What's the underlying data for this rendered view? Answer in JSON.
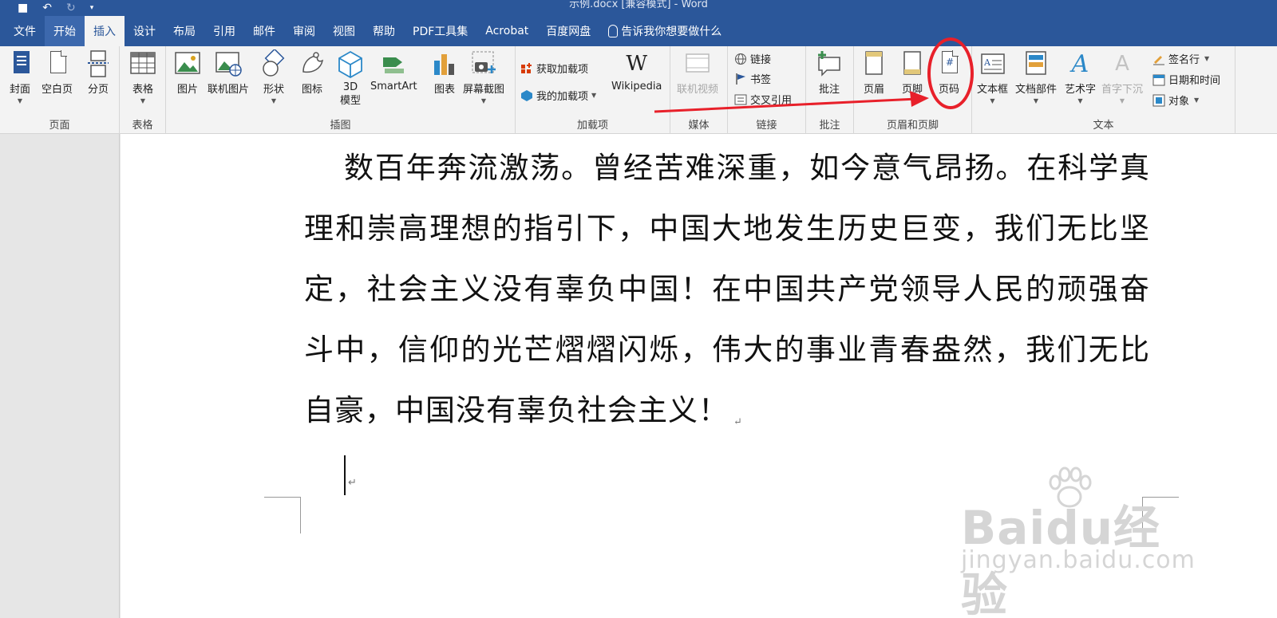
{
  "window": {
    "title": "示例.docx [兼容模式] - Word"
  },
  "tabs": [
    {
      "label": "文件"
    },
    {
      "label": "开始"
    },
    {
      "label": "插入"
    },
    {
      "label": "设计"
    },
    {
      "label": "布局"
    },
    {
      "label": "引用"
    },
    {
      "label": "邮件"
    },
    {
      "label": "审阅"
    },
    {
      "label": "视图"
    },
    {
      "label": "帮助"
    },
    {
      "label": "PDF工具集"
    },
    {
      "label": "Acrobat"
    },
    {
      "label": "百度网盘"
    },
    {
      "label": "告诉我你想要做什么"
    }
  ],
  "active_tab": "插入",
  "ribbon": {
    "pages": {
      "label": "页面",
      "cover": "封面",
      "blank": "空白页",
      "break": "分页"
    },
    "tables": {
      "label": "表格",
      "table": "表格"
    },
    "illustrations": {
      "label": "插图",
      "picture": "图片",
      "online_picture": "联机图片",
      "shapes": "形状",
      "icons": "图标",
      "model3d": "3D\n模型",
      "smartart": "SmartArt",
      "chart": "图表",
      "screenshot": "屏幕截图"
    },
    "addins": {
      "label": "加载项",
      "get": "获取加载项",
      "mine": "我的加载项",
      "wiki_glyph": "W",
      "wikipedia": "Wikipedia"
    },
    "media": {
      "label": "媒体",
      "online_video": "联机视频"
    },
    "links": {
      "label": "链接",
      "link": "链接",
      "bookmark": "书签",
      "cross_ref": "交叉引用"
    },
    "comments": {
      "label": "批注",
      "comment": "批注"
    },
    "header_footer": {
      "label": "页眉和页脚",
      "header": "页眉",
      "footer": "页脚",
      "page_number": "页码",
      "page_number_glyph": "#"
    },
    "text": {
      "label": "文本",
      "textbox": "文本框",
      "quick_parts": "文档部件",
      "wordart": "艺术字",
      "drop_cap": "首字下沉",
      "signature": "签名行",
      "datetime": "日期和时间",
      "object": "对象"
    }
  },
  "document": {
    "paragraph": "数百年奔流激荡。曾经苦难深重，如今意气昂扬。在科学真理和崇高理想的指引下，中国大地发生历史巨变，我们无比坚定，社会主义没有辜负中国！在中国共产党领导人民的顽强奋斗中，信仰的光芒熠熠闪烁，伟大的事业青春盎然，我们无比自豪，中国没有辜负社会主义！",
    "para_mark": "↵"
  },
  "watermark": {
    "logo": "Baidu经验",
    "url": "jingyan.baidu.com"
  },
  "colors": {
    "word_blue": "#2b579a",
    "annotation_red": "#e8202a"
  }
}
